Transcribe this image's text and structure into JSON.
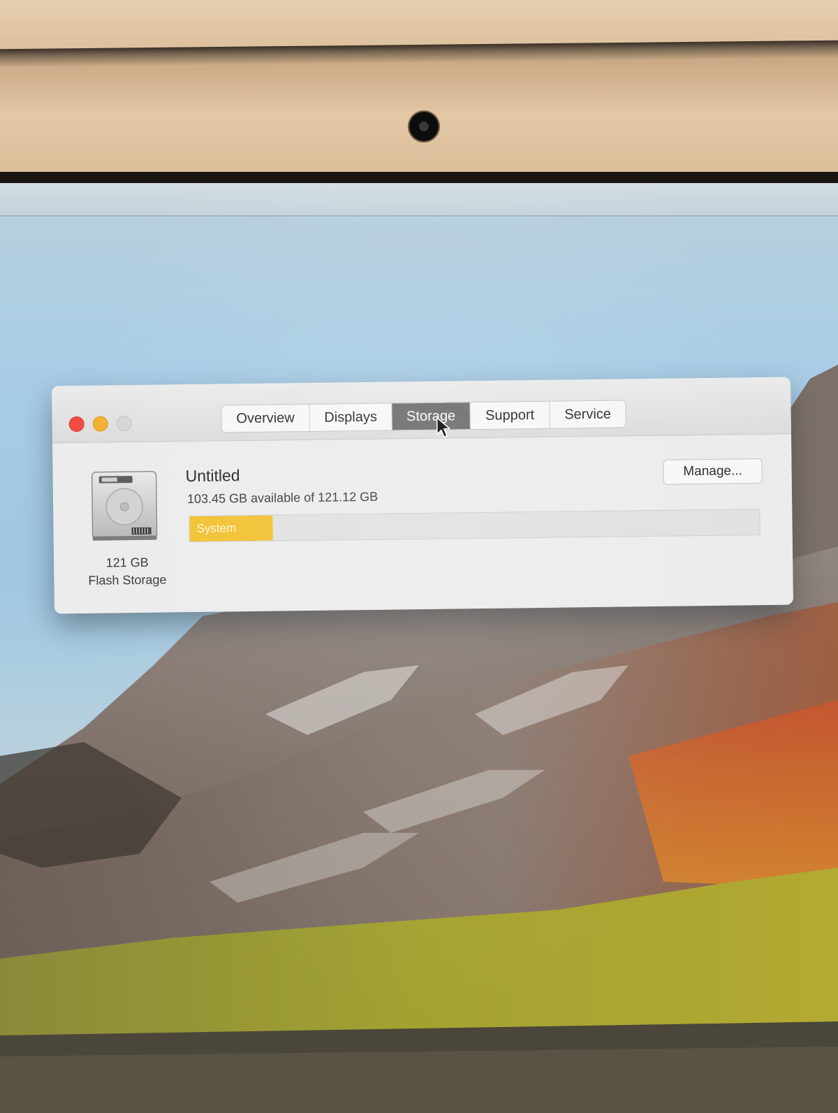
{
  "window": {
    "tabs": [
      {
        "label": "Overview"
      },
      {
        "label": "Displays"
      },
      {
        "label": "Storage"
      },
      {
        "label": "Support"
      },
      {
        "label": "Service"
      }
    ],
    "active_tab": "Storage"
  },
  "storage": {
    "drive_capacity": "121 GB",
    "drive_type": "Flash Storage",
    "volume_name": "Untitled",
    "availability": "103.45 GB available of 121.12 GB",
    "manage_label": "Manage...",
    "segment_label": "System",
    "used_fraction": 0.146,
    "segment_color": "#f2c233"
  },
  "colors": {
    "close": "#f04b44",
    "minimize": "#f5b031",
    "zoom_disabled": "#d6d6d6",
    "active_tab": "#6f6f6f"
  }
}
